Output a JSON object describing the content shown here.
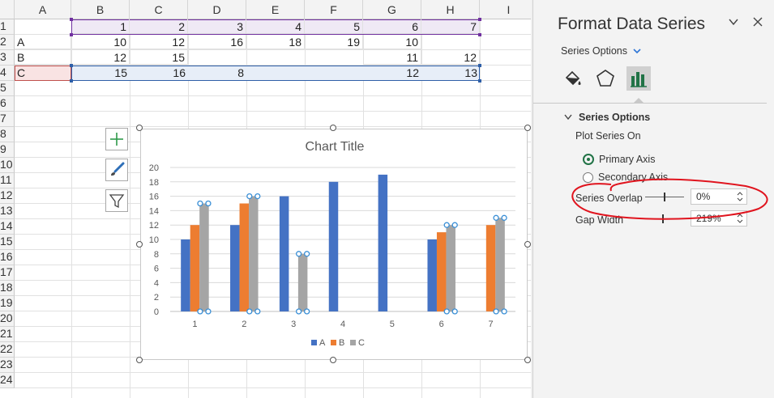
{
  "sheet": {
    "columns": [
      "A",
      "B",
      "C",
      "D",
      "E",
      "F",
      "G",
      "H",
      "I"
    ],
    "rows": [
      "1",
      "2",
      "3",
      "4",
      "5",
      "6",
      "7",
      "8",
      "9",
      "10",
      "11",
      "12",
      "13",
      "14",
      "15",
      "16",
      "17",
      "18",
      "19",
      "20",
      "21",
      "22",
      "23",
      "24"
    ],
    "cells": {
      "r1": [
        "",
        "1",
        "2",
        "3",
        "4",
        "5",
        "6",
        "7"
      ],
      "r2": [
        "A",
        "10",
        "12",
        "16",
        "18",
        "19",
        "10",
        ""
      ],
      "r3": [
        "B",
        "12",
        "15",
        "",
        "",
        "",
        "11",
        "12"
      ],
      "r4": [
        "C",
        "15",
        "16",
        "8",
        "",
        "",
        "12",
        "13"
      ]
    }
  },
  "chart_data": {
    "type": "bar",
    "title": "Chart Title",
    "categories": [
      "1",
      "2",
      "3",
      "4",
      "5",
      "6",
      "7"
    ],
    "series": [
      {
        "name": "A",
        "color": "#4472c4",
        "values": [
          10,
          12,
          16,
          18,
          19,
          10,
          null
        ]
      },
      {
        "name": "B",
        "color": "#ed7d31",
        "values": [
          12,
          15,
          null,
          null,
          null,
          11,
          12
        ]
      },
      {
        "name": "C",
        "color": "#a5a5a5",
        "values": [
          15,
          16,
          8,
          null,
          null,
          12,
          13
        ]
      }
    ],
    "ylim": [
      0,
      20
    ],
    "yticks": [
      "0",
      "2",
      "4",
      "6",
      "8",
      "10",
      "12",
      "14",
      "16",
      "18",
      "20"
    ],
    "grid": true,
    "legend_position": "bottom"
  },
  "chart_tools": {
    "add_element_icon": "plus-icon",
    "style_icon": "brush-icon",
    "filter_icon": "funnel-icon"
  },
  "pane": {
    "title": "Format Data Series",
    "dropdown_label": "Series Options",
    "section_title": "Series Options",
    "plot_on_label": "Plot Series On",
    "primary_axis": "Primary Axis",
    "secondary_axis": "Secondary Axis",
    "overlap_label": "Series Overlap",
    "overlap_value": "0%",
    "gap_label": "Gap Width",
    "gap_value": "219%",
    "accent": "#217346",
    "annotation_color": "#e0141e"
  }
}
